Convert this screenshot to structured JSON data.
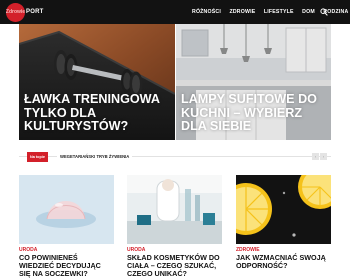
{
  "logo": {
    "badge": "Zdrowie",
    "text": "PORT"
  },
  "nav": {
    "items": [
      "Różności",
      "Zdrowie",
      "Lifestyle",
      "Dom",
      "Rodzina"
    ],
    "search_icon": "search-icon"
  },
  "hero": [
    {
      "title": "Ławka treningowa tylko dla kulturystów?"
    },
    {
      "title": "Lampy sufitowe do kuchni – wybierz dla siebie"
    }
  ],
  "section": {
    "tag": "Na topie",
    "title": "Wegetariański tryb żywienia",
    "prev": "‹",
    "next": "›"
  },
  "cards": [
    {
      "category": "Uroda",
      "title": "Co powinieneś wiedzieć decydując się na soczewki?"
    },
    {
      "category": "Uroda",
      "title": "Skład kosmetyków do ciała – czego szukać, czego unikać?"
    },
    {
      "category": "Zdrowie",
      "title": "Jak wzmacniać swoją odporność?"
    }
  ],
  "colors": {
    "accent": "#d3202a",
    "nav_bg": "#121212"
  }
}
